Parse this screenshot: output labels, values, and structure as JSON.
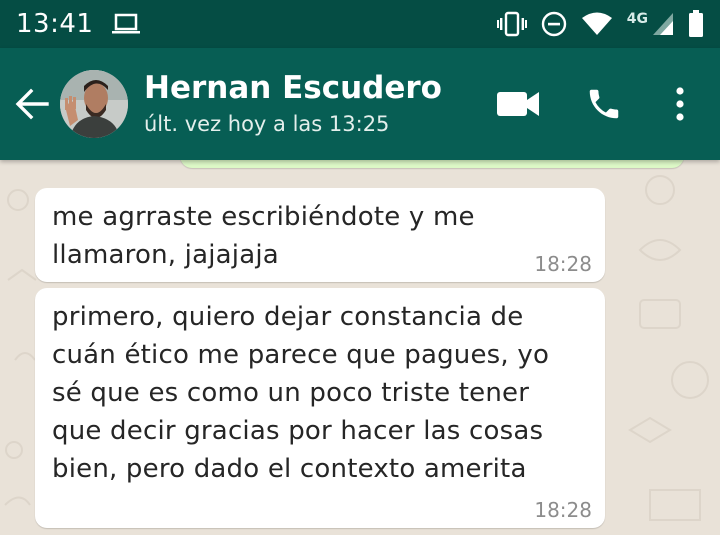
{
  "status_bar": {
    "time": "13:41",
    "network_label": "4G"
  },
  "header": {
    "contact_name": "Hernan Escudero",
    "last_seen": "últ. vez hoy a las 13:25"
  },
  "messages": [
    {
      "text": "me agrraste escribiéndote y me\nllamaron, jajajaja",
      "time": "18:28"
    },
    {
      "text": "primero, quiero dejar constancia de\ncuán ético me parece que pagues, yo\nsé que es como un poco triste tener\nque decir gracias por hacer las cosas\nbien, pero dado el contexto amerita",
      "time": "18:28"
    }
  ],
  "colors": {
    "status_bar": "#054d44",
    "toolbar": "#075e54",
    "chat_background": "#e9e2d8",
    "incoming_bubble": "#ffffff",
    "outgoing_bubble": "#dcf8c6"
  },
  "icons": {
    "status_left": [
      "laptop-icon"
    ],
    "status_right": [
      "vibrate-icon",
      "do-not-disturb-icon",
      "wifi-icon",
      "signal-icon",
      "battery-icon"
    ],
    "toolbar": [
      "back-arrow-icon",
      "video-call-icon",
      "phone-icon",
      "more-vert-icon"
    ]
  }
}
